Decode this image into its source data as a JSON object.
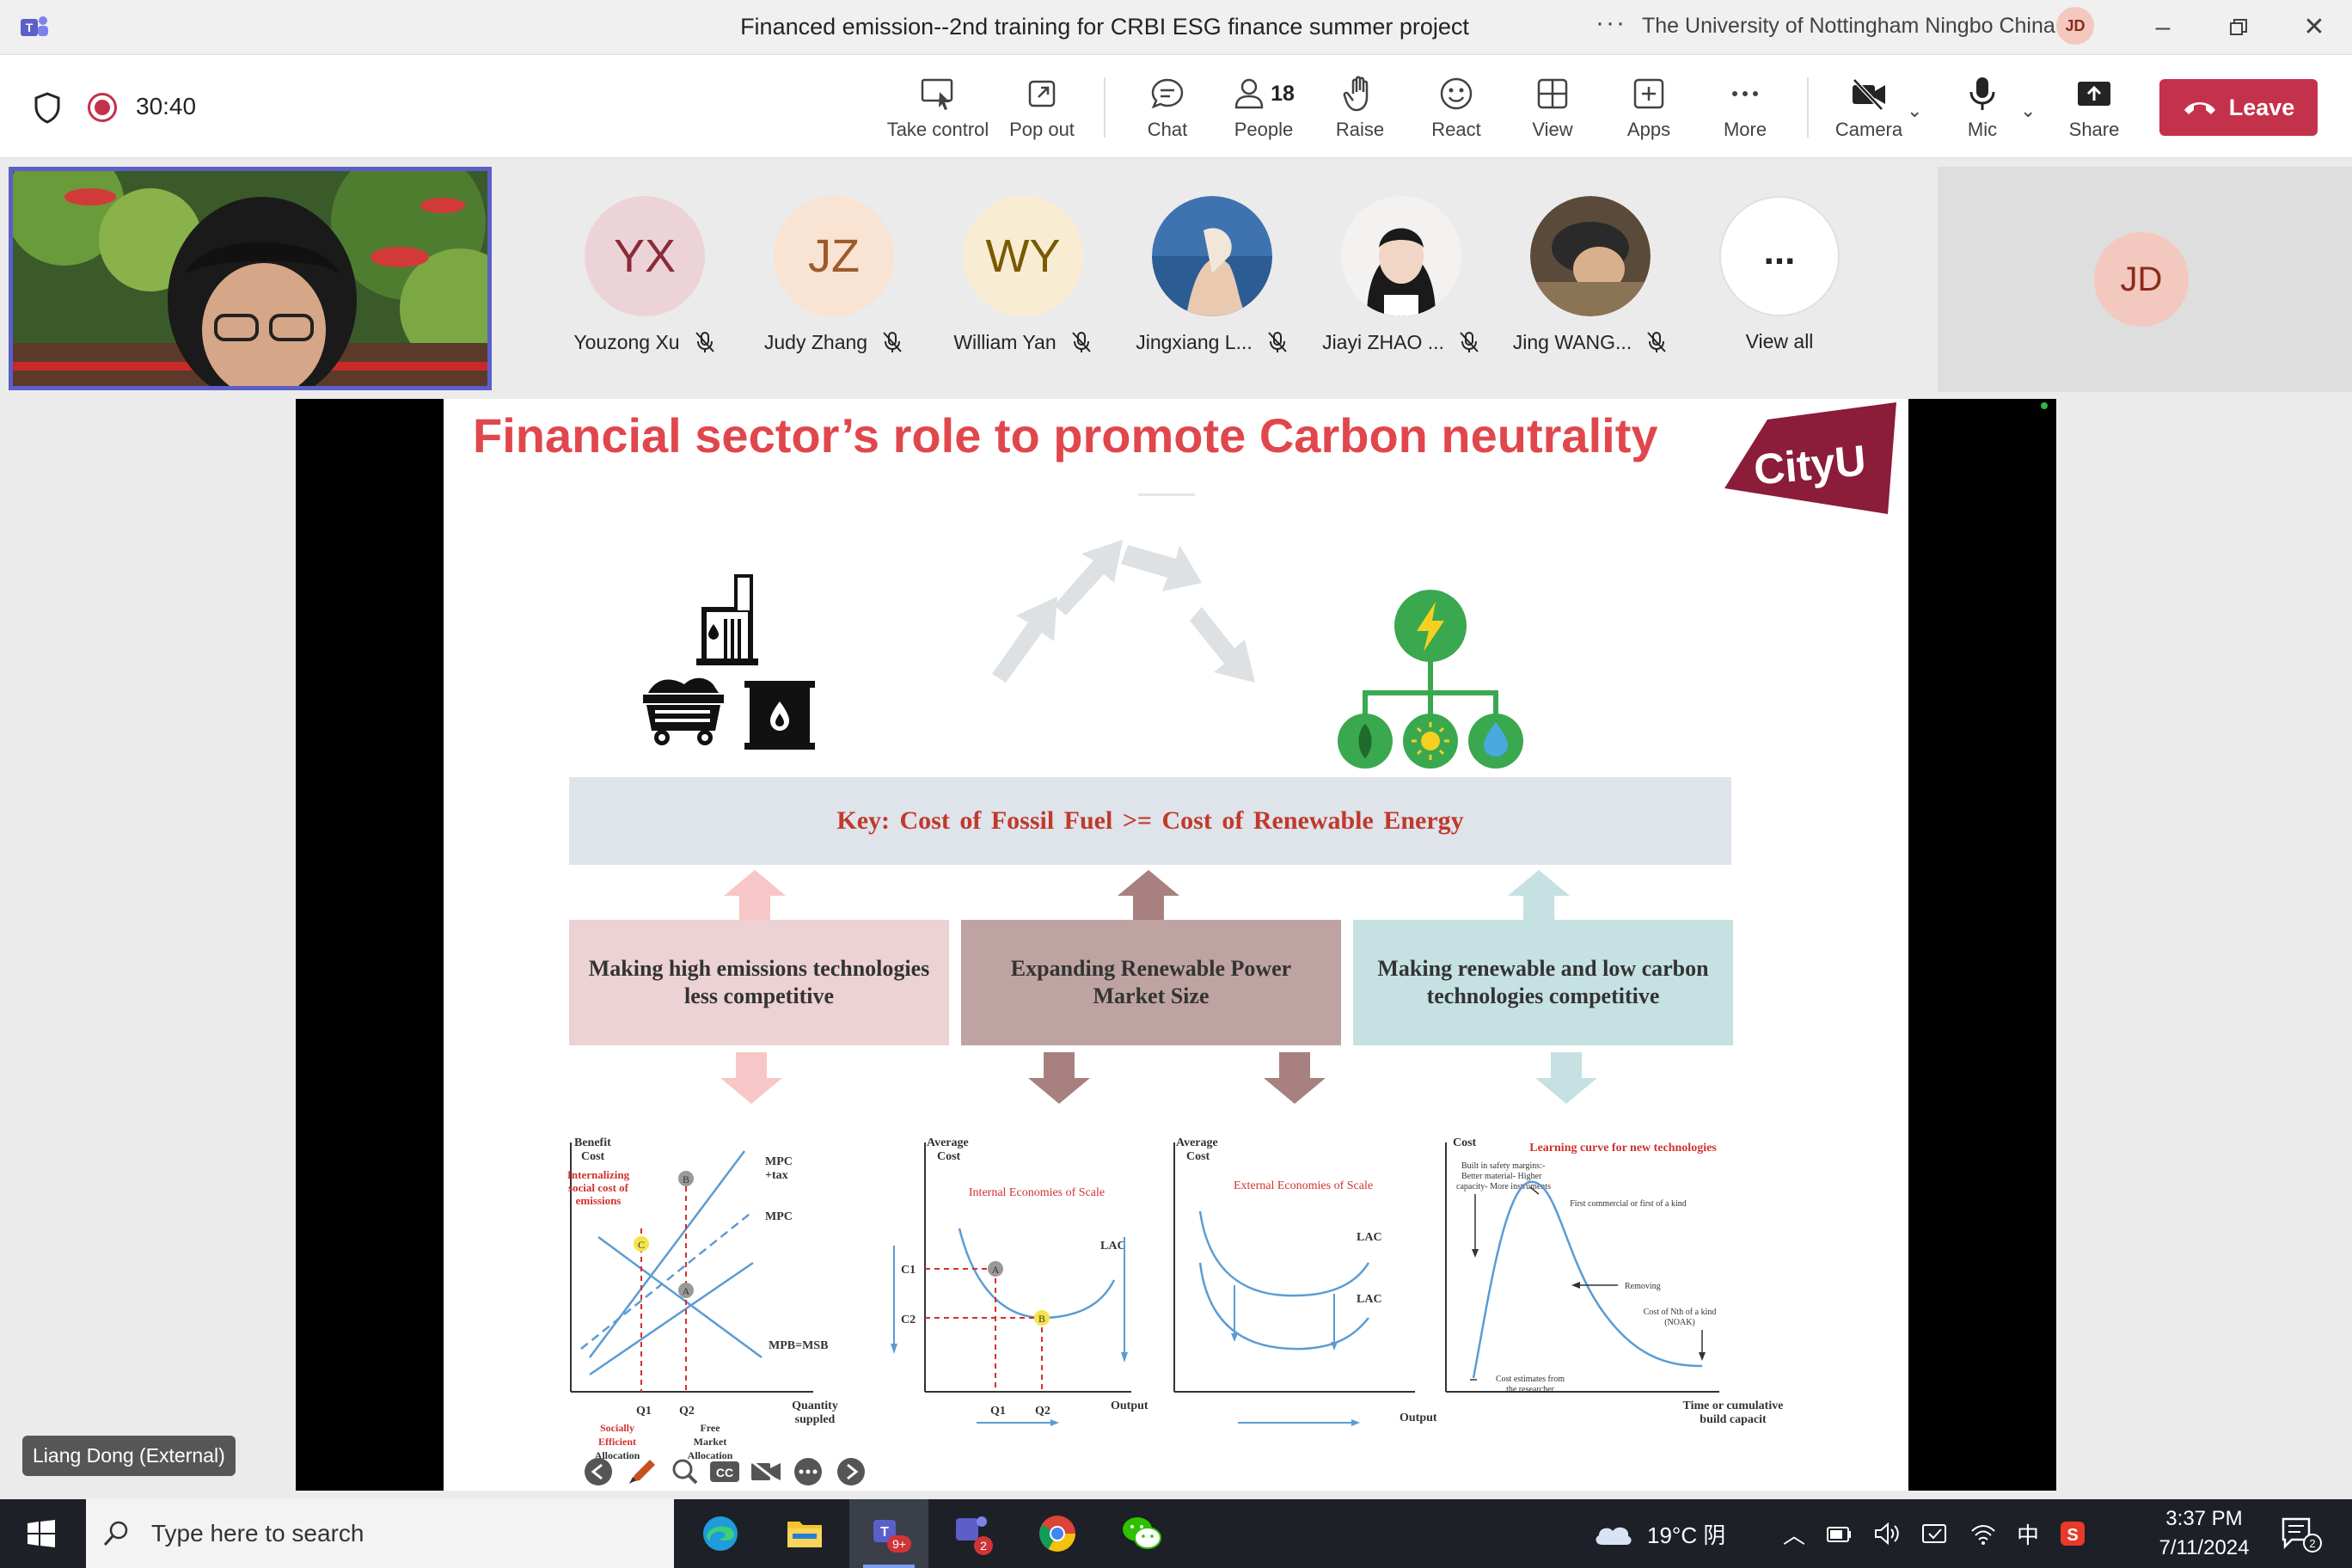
{
  "window": {
    "title": "Financed emission--2nd training for CRBI ESG finance summer project",
    "org": "The University of Nottingham Ningbo China",
    "user_initials": "JD"
  },
  "toolbar": {
    "timer": "30:40",
    "buttons": [
      {
        "label": "Take control",
        "icon": "take-control-icon"
      },
      {
        "label": "Pop out",
        "icon": "pop-out-icon"
      },
      {
        "label": "Chat",
        "icon": "chat-icon"
      },
      {
        "label": "People",
        "icon": "people-icon",
        "count": "18"
      },
      {
        "label": "Raise",
        "icon": "raise-hand-icon"
      },
      {
        "label": "React",
        "icon": "react-icon"
      },
      {
        "label": "View",
        "icon": "view-icon"
      },
      {
        "label": "Apps",
        "icon": "apps-icon"
      },
      {
        "label": "More",
        "icon": "more-icon"
      },
      {
        "label": "Camera",
        "icon": "camera-off-icon"
      },
      {
        "label": "Mic",
        "icon": "mic-icon"
      },
      {
        "label": "Share",
        "icon": "share-icon"
      }
    ],
    "leave_label": "Leave"
  },
  "participants": [
    {
      "initials": "YX",
      "name": "Youzong Xu",
      "bg": "#ecd3d7",
      "fg": "#8a2b3a"
    },
    {
      "initials": "JZ",
      "name": "Judy Zhang",
      "bg": "#f9e3d2",
      "fg": "#a05a2c"
    },
    {
      "initials": "WY",
      "name": "William Yan",
      "bg": "#f8ecd2",
      "fg": "#7a5a00"
    },
    {
      "initials": "",
      "name": "Jingxiang L...",
      "bg": "#4b7fb8",
      "fg": "#fff"
    },
    {
      "initials": "",
      "name": "Jiayi ZHAO ...",
      "bg": "#e9e6e4",
      "fg": "#fff"
    },
    {
      "initials": "",
      "name": "Jing WANG...",
      "bg": "#6b5440",
      "fg": "#fff"
    },
    {
      "initials": "...",
      "name": "View all",
      "bg": "#ffffff",
      "fg": "#242424"
    }
  ],
  "right_tile": {
    "initials": "JD"
  },
  "slide": {
    "title": "Financial sector’s role to promote Carbon neutrality",
    "logo_text": "CityU",
    "key_text": "Key:   Cost of Fossil Fuel   >=  Cost of Renewable Energy",
    "boxes": [
      {
        "text": "Making high emissions technologies less competitive",
        "bg": "#ecd2d4"
      },
      {
        "text": "Expanding Renewable Power Market Size",
        "bg": "#bfa3a3"
      },
      {
        "text": "Making renewable and low carbon technologies competitive",
        "bg": "#c5e1e1"
      }
    ],
    "graph1": {
      "y_label": "Benefit\nCost",
      "note": "Internalizing social cost of emissions",
      "curves": [
        "MPC +tax",
        "MPC",
        "MPB=MSB"
      ],
      "points": [
        "B",
        "C",
        "A"
      ],
      "x_ticks": [
        "Q1",
        "Q2"
      ],
      "x_label": "Quantity supplied",
      "bottom_labels": [
        "Socially Efficient Allocation",
        "Free Market Allocation"
      ]
    },
    "graph2": {
      "y_label": "Average\nCost",
      "title": "Internal Economies of Scale",
      "curve": "LAC",
      "y_ticks": [
        "C1",
        "C2"
      ],
      "points": [
        "A",
        "B"
      ],
      "x_ticks": [
        "Q1",
        "Q2"
      ],
      "x_label": "Output"
    },
    "graph3": {
      "y_label": "Average\nCost",
      "title": "External Economies of Scale",
      "curves": [
        "LAC",
        "LAC"
      ],
      "x_label": "Output"
    },
    "graph4": {
      "y_label": "Cost",
      "title": "Learning curve for new technologies",
      "notes": [
        "Built in safety margins:- Better material- Higher capacity- More instruments",
        "First commercial or first of a kind",
        "Removing",
        "Cost of Nth of a kind (NOAK)",
        "Cost estimates from the researcher"
      ],
      "x_label": "Time or cumulative build capacit"
    }
  },
  "speaker_name": "Liang Dong (External)",
  "taskbar": {
    "search_placeholder": "Type here to search",
    "weather": "19°C 阴",
    "ime": "中",
    "time": "3:37 PM",
    "date": "7/11/2024",
    "teams_badge": "9+",
    "teams2_badge": "2",
    "notif_badge": "2"
  },
  "colors": {
    "accent_red": "#c4314b",
    "slide_title_red": "#e0474c",
    "teams_purple": "#5b5fc7"
  }
}
